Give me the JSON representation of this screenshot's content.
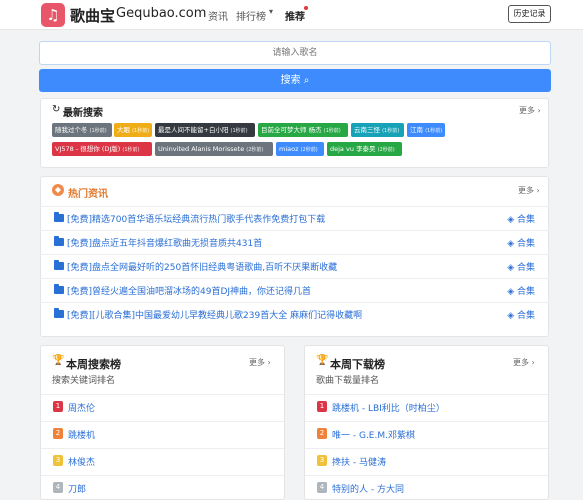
{
  "header": {
    "logo_icon": "music-note-icon",
    "logo_cn": "歌曲宝",
    "logo_en": "Gequbao.com",
    "nav": {
      "news": "资讯",
      "rank": "排行榜",
      "recommend": "推荐"
    },
    "history_button": "历史记录"
  },
  "search": {
    "placeholder": "请输入歌名",
    "button_label": "搜索"
  },
  "recent": {
    "title": "最新搜索",
    "more": "更多",
    "tags": [
      {
        "text": "随我过个冬",
        "count": "(1秒前)",
        "color": "#6c757d"
      },
      {
        "text": "大眠",
        "count": "(1秒前)",
        "color": "#f0ad1a"
      },
      {
        "text": "最是人间不能留+白小阳",
        "count": "(1秒前)",
        "color": "#343a40"
      },
      {
        "text": "目前全可梦大师 杨杰",
        "count": "(1秒前)",
        "color": "#28a745"
      },
      {
        "text": "云南三怪",
        "count": "(1秒前)",
        "color": "#17a2b8"
      },
      {
        "text": "江南",
        "count": "(1秒前)",
        "color": "#3d8bfd"
      },
      {
        "text": "VJ578 - 很想你 (DJ版)",
        "count": "(1秒前)",
        "color": "#dc3545"
      },
      {
        "text": "Uninvited Alanis Morissete",
        "count": "(2秒前)",
        "color": "#6c757d"
      },
      {
        "text": "miaoz",
        "count": "(2秒前)",
        "color": "#3d8bfd"
      },
      {
        "text": "deja vu 李泰昊",
        "count": "(2秒前)",
        "color": "#28a745"
      }
    ]
  },
  "hot_news": {
    "title": "热门资讯",
    "more": "更多",
    "items": [
      {
        "text": "[免费]精选700首华语乐坛经典流行热门歌手代表作免费打包下载",
        "tag": "合集"
      },
      {
        "text": "[免费]盘点近五年抖音爆红歌曲无损音质共431首",
        "tag": "合集"
      },
      {
        "text": "[免费]盘点全网最好听的250首怀旧经典粤语歌曲,百听不厌果断收藏",
        "tag": "合集"
      },
      {
        "text": "[免费]曾经火遍全国油吧溜冰场的49首DJ神曲，你还记得几首",
        "tag": "合集"
      },
      {
        "text": "[免费][儿歌合集]中国最爱幼儿早教经典儿歌239首大全 麻麻们记得收藏啊",
        "tag": "合集"
      }
    ]
  },
  "weekly_search": {
    "title": "本周搜索榜",
    "subtitle": "搜索关键词排名",
    "more": "更多",
    "items": [
      {
        "rank": "1",
        "text": "周杰伦",
        "color": "#dc3545"
      },
      {
        "rank": "2",
        "text": "跳楼机",
        "color": "#f0813a"
      },
      {
        "rank": "3",
        "text": "林俊杰",
        "color": "#f0c23a"
      },
      {
        "rank": "4",
        "text": "刀郎",
        "color": "#adb5bd"
      }
    ]
  },
  "weekly_download": {
    "title": "本周下载榜",
    "subtitle": "歌曲下载量排名",
    "more": "更多",
    "items": [
      {
        "rank": "1",
        "text": "跳楼机 - LBI利比（时柏尘）",
        "color": "#dc3545"
      },
      {
        "rank": "2",
        "text": "唯一 - G.E.M.邓紫棋",
        "color": "#f0813a"
      },
      {
        "rank": "3",
        "text": "搀扶 - 马健涛",
        "color": "#f0c23a"
      },
      {
        "rank": "4",
        "text": "特别的人 - 方大同",
        "color": "#adb5bd"
      }
    ]
  }
}
